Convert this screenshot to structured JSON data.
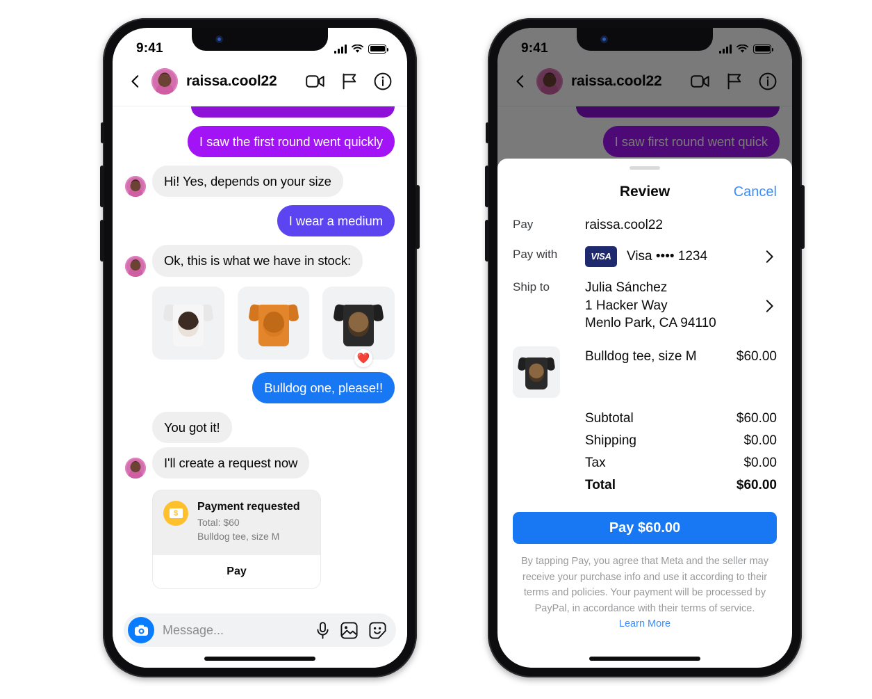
{
  "left_phone": {
    "status_bar": {
      "time": "9:41",
      "signal_icon": "cellular-bars-icon",
      "wifi_icon": "wifi-icon",
      "battery_icon": "battery-full-icon"
    },
    "header": {
      "back_icon": "back-chevron-icon",
      "avatar": "user-avatar",
      "username": "raissa.cool22",
      "video_icon": "video-camera-icon",
      "flag_icon": "flag-icon",
      "info_icon": "info-circle-icon"
    },
    "messages": [
      {
        "id": "m0",
        "side": "out",
        "style": "purple-clip",
        "text": ""
      },
      {
        "id": "m1",
        "side": "out",
        "style": "purple-bright",
        "text": "I saw the first round went quickly"
      },
      {
        "id": "m2",
        "side": "in",
        "style": "grey",
        "text": "Hi! Yes, depends on your size",
        "avatar": true
      },
      {
        "id": "m3",
        "side": "out",
        "style": "purple-mid",
        "text": "I wear a medium"
      },
      {
        "id": "m4",
        "side": "in",
        "style": "grey",
        "text": "Ok, this is what we have in stock:",
        "avatar": true
      },
      {
        "id": "m6",
        "side": "out",
        "style": "blue",
        "text": "Bulldog one, please!!"
      },
      {
        "id": "m7",
        "side": "in",
        "style": "grey",
        "text": "You got it!",
        "avatar": false
      },
      {
        "id": "m8",
        "side": "in",
        "style": "grey",
        "text": "I'll create a request now",
        "avatar": true
      }
    ],
    "products": [
      {
        "name": "border-collie-tee",
        "shirt_color": "#f3f3f3",
        "dog_color": "#3b2b22",
        "reaction": ""
      },
      {
        "name": "golden-retriever-tee",
        "shirt_color": "#e2852b",
        "dog_color": "#c96f1c",
        "reaction": ""
      },
      {
        "name": "bulldog-tee",
        "shirt_color": "#2a2a2a",
        "dog_color": "#6f5234",
        "reaction": "❤️"
      }
    ],
    "payment_request": {
      "icon": "money-note-icon",
      "icon_glyph": "$",
      "title": "Payment requested",
      "total_line": "Total: $60",
      "item_line": "Bulldog tee, size M",
      "button_label": "Pay"
    },
    "composer": {
      "camera_icon": "camera-icon",
      "placeholder": "Message...",
      "mic_icon": "microphone-icon",
      "gallery_icon": "photo-gallery-icon",
      "sticker_icon": "sticker-smiley-icon"
    }
  },
  "right_phone": {
    "status_bar": {
      "time": "9:41",
      "signal_icon": "cellular-bars-icon",
      "wifi_icon": "wifi-icon",
      "battery_icon": "battery-full-icon"
    },
    "header": {
      "back_icon": "back-chevron-icon",
      "avatar": "user-avatar",
      "username": "raissa.cool22",
      "video_icon": "video-camera-icon",
      "flag_icon": "flag-icon",
      "info_icon": "info-circle-icon"
    },
    "background_message": "I saw first round went quick",
    "sheet": {
      "grab_handle": "sheet-grab-handle",
      "title": "Review",
      "cancel_label": "Cancel",
      "pay_label": "Pay",
      "pay_value": "raissa.cool22",
      "pay_with_label": "Pay with",
      "card_brand": "VISA",
      "card_value": "Visa •••• 1234",
      "ship_to_label": "Ship to",
      "ship_to_lines": [
        "Julia Sánchez",
        "1 Hacker Way",
        "Menlo Park, CA 94110"
      ],
      "item": {
        "thumb": "bulldog-tee-thumb",
        "name": "Bulldog tee, size M",
        "price": "$60.00"
      },
      "totals": [
        {
          "label": "Subtotal",
          "value": "$60.00",
          "bold": false
        },
        {
          "label": "Shipping",
          "value": "$0.00",
          "bold": false
        },
        {
          "label": "Tax",
          "value": "$0.00",
          "bold": false
        },
        {
          "label": "Total",
          "value": "$60.00",
          "bold": true
        }
      ],
      "pay_button_label": "Pay $60.00",
      "legal_text": "By tapping Pay, you agree that Meta and the seller may receive your purchase info and use it according to their terms and policies. Your payment will be processed by PayPal, in accordance with their terms of service.",
      "legal_link": "Learn More"
    }
  },
  "colors": {
    "purple_bright": "#a214f5",
    "purple_mid": "#5c45f0",
    "blue_bubble": "#1877f2",
    "link_blue": "#3f8ef7",
    "grey_bubble": "#efefef",
    "coin_yellow": "#ffc02e",
    "visa_navy": "#1f2a6e"
  }
}
